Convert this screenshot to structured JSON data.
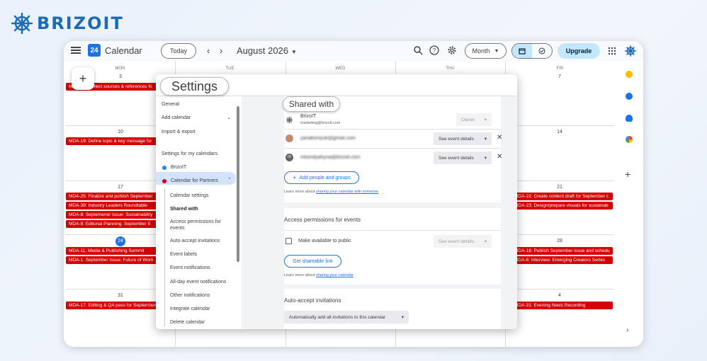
{
  "brand": {
    "name": "BRIZOIT"
  },
  "topbar": {
    "app_title": "Calendar",
    "calendar_icon_day": "24",
    "today_label": "Today",
    "prev": "‹",
    "next": "›",
    "period": "August 2026",
    "view_label": "Month",
    "upgrade_label": "Upgrade"
  },
  "grid": {
    "weekdays": [
      "MON",
      "TUE",
      "WED",
      "THU",
      "FRI"
    ],
    "day_numbers": {
      "r1": {
        "mon": "3",
        "fri": "7"
      },
      "r2": {
        "mon": "10",
        "fri": "14"
      },
      "r3": {
        "mon": "17",
        "fri": "21"
      },
      "r4": {
        "mon": "24",
        "fri": "28"
      },
      "r5": {
        "mon": "31",
        "fri": "4"
      }
    },
    "events": {
      "mon": [
        "MDA-21: Collect sources & references fo",
        "MDA-19: Define topic & key message for",
        "MDA-25: Finalize and publish September",
        "MDA-39: Industry Leaders Roundtable",
        "MDA-8: Septemener Issue: Sustainability",
        "MDA-9: Editorial Planning: September E",
        "MDA-11: Media & Publishing Summit",
        "MDA-1: September Issue: Future of Work",
        "MDA-17: Editing & QA pass for September"
      ],
      "fri": [
        "MDA-22: Create content draft for September c",
        "MDA-23: Design/prepare visuals for sustainab",
        "MDA-18: Publish September issue and schedu",
        "MDA-6: Interview: Emerging Creators Series",
        "MDA-31: Evening News Recording"
      ]
    },
    "event_color": "#d50000"
  },
  "settings": {
    "title": "Settings",
    "nav": {
      "general": "General",
      "add_calendar": "Add calendar",
      "import_export": "Import & export",
      "my_calendars_header": "Settings for my calendars",
      "cal1": "BrizoIT",
      "cal2": "Calendar for Partners"
    },
    "sub": [
      "Calendar settings",
      "Shared with",
      "Access permissions for events",
      "Auto-accept invitations",
      "Event labels",
      "Event notifications",
      "All-day event notifications",
      "Other notifications",
      "Integrate calendar",
      "Delete calendar"
    ],
    "shared": {
      "section_label": "Shared with",
      "owner_name": "BrizoIT",
      "owner_email": "marketing@brizoit.com",
      "owner_role": "Owner",
      "user1_email": "yanakoniyuk@gmail.com",
      "user1_role": "See event details",
      "user2_email": "mkondyahyna@brizoit.com",
      "user2_role": "See event details",
      "add_button": "Add people and groups",
      "note_prefix": "Learn more about ",
      "note_link": "sharing your calendar with someone"
    },
    "access": {
      "title": "Access permissions for events",
      "public_label": "Make available to public",
      "public_role": "See event details",
      "link_button": "Get shareable link",
      "note_prefix": "Learn more about ",
      "note_link": "sharing your calendar"
    },
    "auto_accept": {
      "title": "Auto-accept invitations",
      "value": "Automatically add all invitations to this calendar"
    }
  }
}
